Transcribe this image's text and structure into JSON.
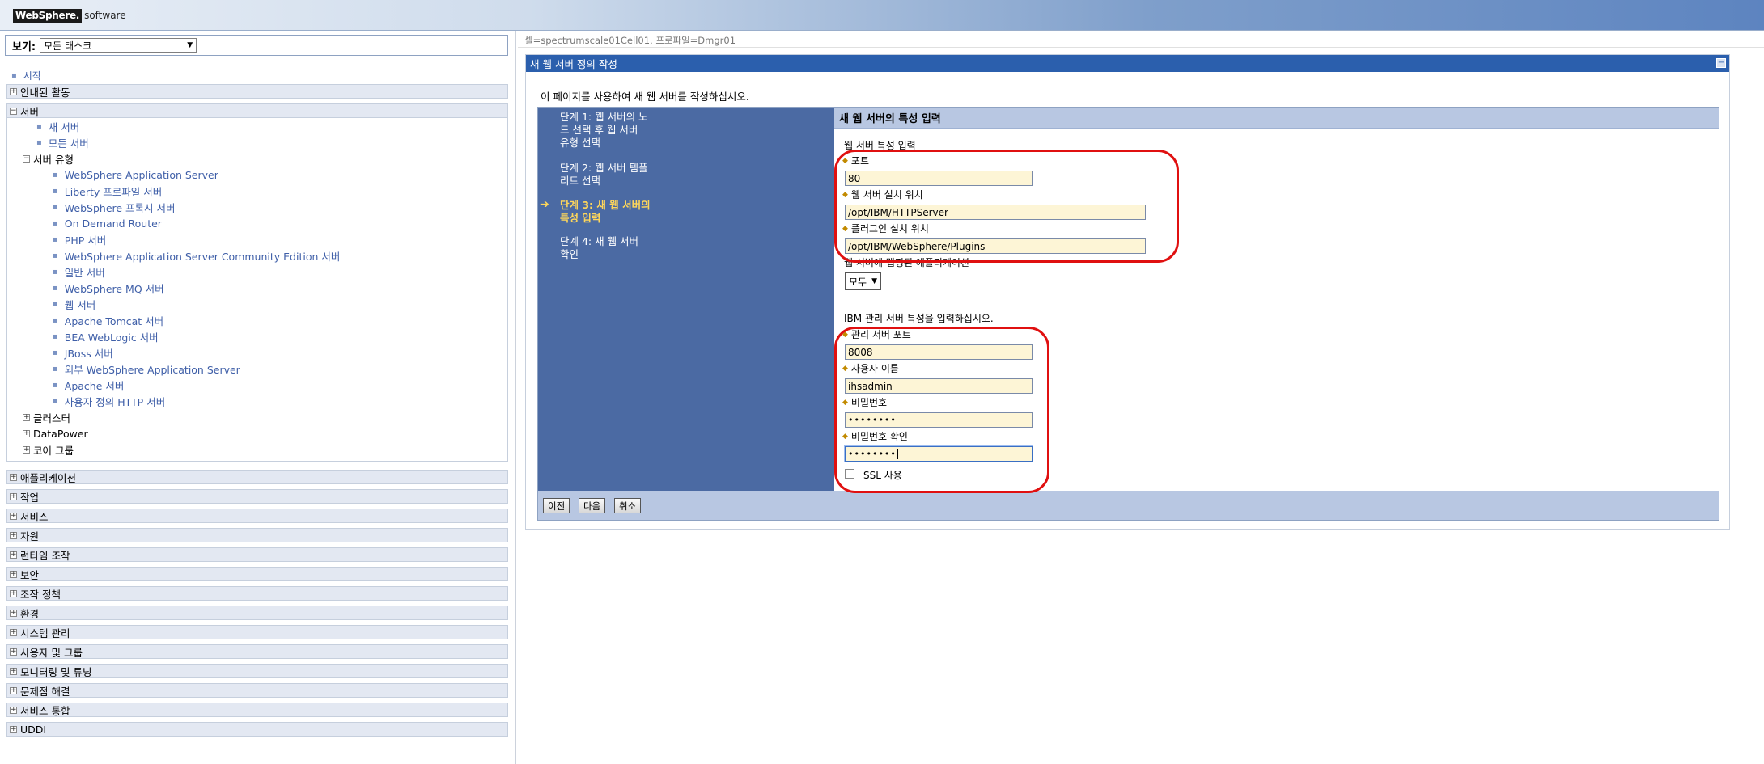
{
  "brand": {
    "logo_text": "WebSphere.",
    "logo_suffix": "software"
  },
  "nav": {
    "view_label": "보기:",
    "view_select": "모든 태스크",
    "start": "시작",
    "sections_top": [
      {
        "label": "안내된 활동"
      }
    ],
    "server_section": "서버",
    "server_items": [
      "새 서버",
      "모든 서버"
    ],
    "server_types_label": "서버 유형",
    "server_types": [
      "WebSphere Application Server",
      "Liberty 프로파일 서버",
      "WebSphere 프록시 서버",
      "On Demand Router",
      "PHP 서버",
      "WebSphere Application Server Community Edition 서버",
      "일반 서버",
      "WebSphere MQ 서버",
      "웹 서버",
      "Apache Tomcat 서버",
      "BEA WebLogic 서버",
      "JBoss 서버",
      "외부 WebSphere Application Server",
      "Apache 서버",
      "사용자 정의 HTTP 서버"
    ],
    "server_groups": [
      "클러스터",
      "DataPower",
      "코어 그룹"
    ],
    "sections": [
      "애플리케이션",
      "작업",
      "서비스",
      "자원",
      "런타임 조작",
      "보안",
      "조작 정책",
      "환경",
      "시스템 관리",
      "사용자 및 그룹",
      "모니터링 및 튜닝",
      "문제점 해결",
      "서비스 통합",
      "UDDI"
    ]
  },
  "breadcrumb": "셀=spectrumscale01Cell01, 프로파일=Dmgr01",
  "panel": {
    "title": "새 웹 서버 정의 작성",
    "intro": "이 페이지를 사용하여 새 웹 서버를 작성하십시오.",
    "steps": [
      {
        "line1": "단계 1: 웹 서버의 노",
        "line2": "드 선택 후 웹 서버",
        "line3": "유형 선택"
      },
      {
        "line1": "단계 2: 웹 서버 템플",
        "line2": "리트 선택",
        "line3": ""
      },
      {
        "line1": "단계 3: 새 웹 서버의",
        "line2": "특성 입력",
        "line3": ""
      },
      {
        "line1": "단계 4: 새 웹 서버",
        "line2": "확인",
        "line3": ""
      }
    ],
    "content_title": "새 웹 서버의 특성 입력",
    "web_props_label": "웹 서버 특성 입력",
    "port_label": "포트",
    "port_value": "80",
    "install_label": "웹 서버 설치 위치",
    "install_value": "/opt/IBM/HTTPServer",
    "plugin_label": "플러그인 설치 위치",
    "plugin_value": "/opt/IBM/WebSphere/Plugins",
    "mapping_label": "웹 서버에 맵핑된 애플리케이션",
    "mapping_value": "모두",
    "admin_intro": "IBM 관리 서버 특성을 입력하십시오.",
    "admin_port_label": "관리 서버 포트",
    "admin_port_value": "8008",
    "user_label": "사용자 이름",
    "user_value": "ihsadmin",
    "password_label": "비밀번호",
    "password_value": "••••••••",
    "password_confirm_label": "비밀번호 확인",
    "password_confirm_value": "••••••••",
    "ssl_label": "SSL 사용",
    "ssl_checked": false,
    "buttons": {
      "prev": "이전",
      "next": "다음",
      "cancel": "취소"
    }
  },
  "colors": {
    "accent": "#2b5fad",
    "steps_bg": "#4b6aa3",
    "highlight": "#e01010",
    "input_bg": "#fdf5d6"
  }
}
